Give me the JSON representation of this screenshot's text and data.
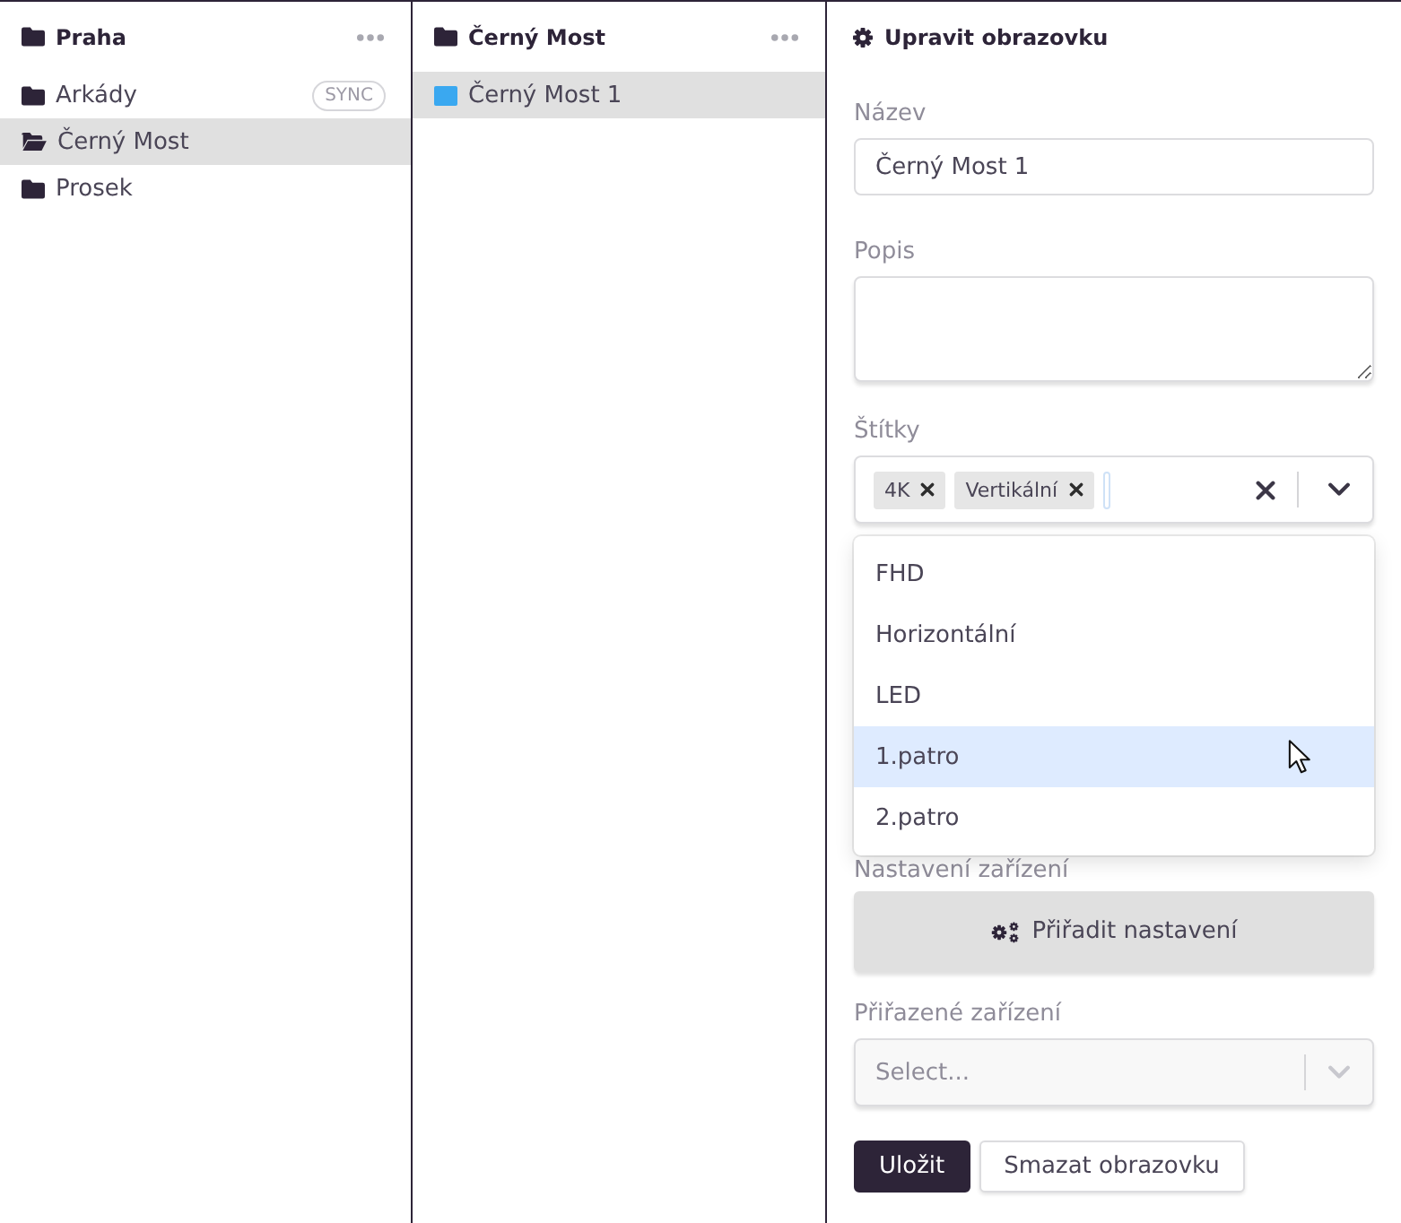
{
  "locations": {
    "title": "Praha",
    "items": [
      {
        "label": "Arkády",
        "badge": "SYNC",
        "selected": false
      },
      {
        "label": "Černý Most",
        "selected": true
      },
      {
        "label": "Prosek",
        "selected": false
      }
    ]
  },
  "screens": {
    "title": "Černý Most",
    "items": [
      {
        "label": "Černý Most 1",
        "selected": true
      }
    ]
  },
  "editor": {
    "title": "Upravit obrazovku",
    "fields": [
      {
        "kind": "text",
        "label": "Název",
        "value": "Černý Most 1"
      },
      {
        "kind": "textarea",
        "label": "Popis"
      },
      {
        "kind": "tags",
        "label": "Štítky",
        "tags": [
          "4K",
          "Vertikální"
        ],
        "menu_open": true,
        "options": [
          {
            "label": "FHD",
            "highlighted": false
          },
          {
            "label": "Horizontální",
            "highlighted": false
          },
          {
            "label": "LED",
            "highlighted": false
          },
          {
            "label": "1.patro",
            "highlighted": true
          },
          {
            "label": "2.patro",
            "highlighted": false
          }
        ]
      },
      {
        "kind": "button",
        "label": "Nastavení zařízení",
        "button": "Přiřadit nastavení"
      },
      {
        "kind": "select",
        "label": "Přiřazené zařízení",
        "placeholder": "Select...",
        "disabled": true
      }
    ],
    "actions": [
      {
        "label": "Uložit",
        "kind": "primary"
      },
      {
        "label": "Smazat obrazovku",
        "kind": "secondary"
      }
    ]
  }
}
